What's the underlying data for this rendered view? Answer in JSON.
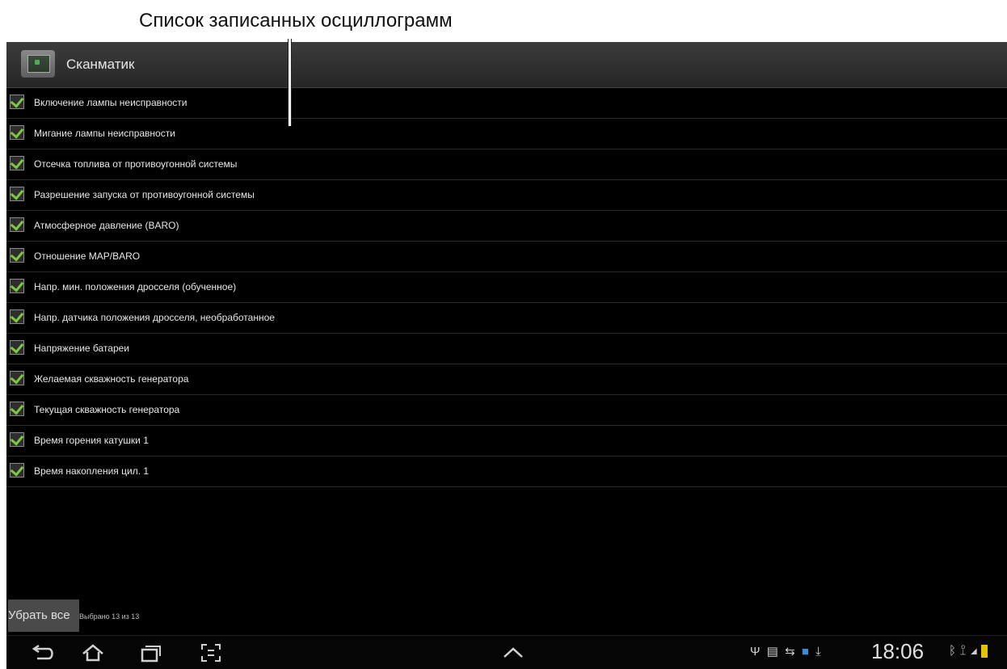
{
  "caption": {
    "text": "Список записанных осциллограмм"
  },
  "app": {
    "title": "Сканматик"
  },
  "list": {
    "items": [
      {
        "label": "Включение лампы неисправности",
        "checked": true
      },
      {
        "label": "Мигание лампы неисправности",
        "checked": true
      },
      {
        "label": "Отсечка топлива от противоугонной системы",
        "checked": true
      },
      {
        "label": "Разрешение запуска от противоугонной системы",
        "checked": true
      },
      {
        "label": "Атмосферное давление (BARO)",
        "checked": true
      },
      {
        "label": "Отношение MAP/BARO",
        "checked": true
      },
      {
        "label": "Напр. мин. положения дросселя (обученное)",
        "checked": true
      },
      {
        "label": "Напр. датчика положения дросселя, необработанное",
        "checked": true
      },
      {
        "label": "Напряжение батареи",
        "checked": true
      },
      {
        "label": "Желаемая скважность генератора",
        "checked": true
      },
      {
        "label": "Текущая скважность генератора",
        "checked": true
      },
      {
        "label": "Время горения катушки 1",
        "checked": true
      },
      {
        "label": "Время накопления цил. 1",
        "checked": true
      }
    ]
  },
  "footer": {
    "remove_all_label": "Убрать все",
    "selected_text": "Выбрано 13 из 13"
  },
  "navbar": {
    "clock": "18:06",
    "icons": [
      "back-icon",
      "home-icon",
      "recent-apps-icon",
      "screenshot-icon",
      "chevron-up-icon"
    ],
    "status_icons": [
      "usb-icon",
      "sd-card-icon",
      "sync-icon",
      "app-notification-icon",
      "download-icon",
      "bluetooth-icon",
      "wifi-icon",
      "signal-icon",
      "battery-icon"
    ]
  },
  "colors": {
    "check_accent": "#7ec642",
    "battery": "#e6c300",
    "screen_bg": "#000000"
  }
}
